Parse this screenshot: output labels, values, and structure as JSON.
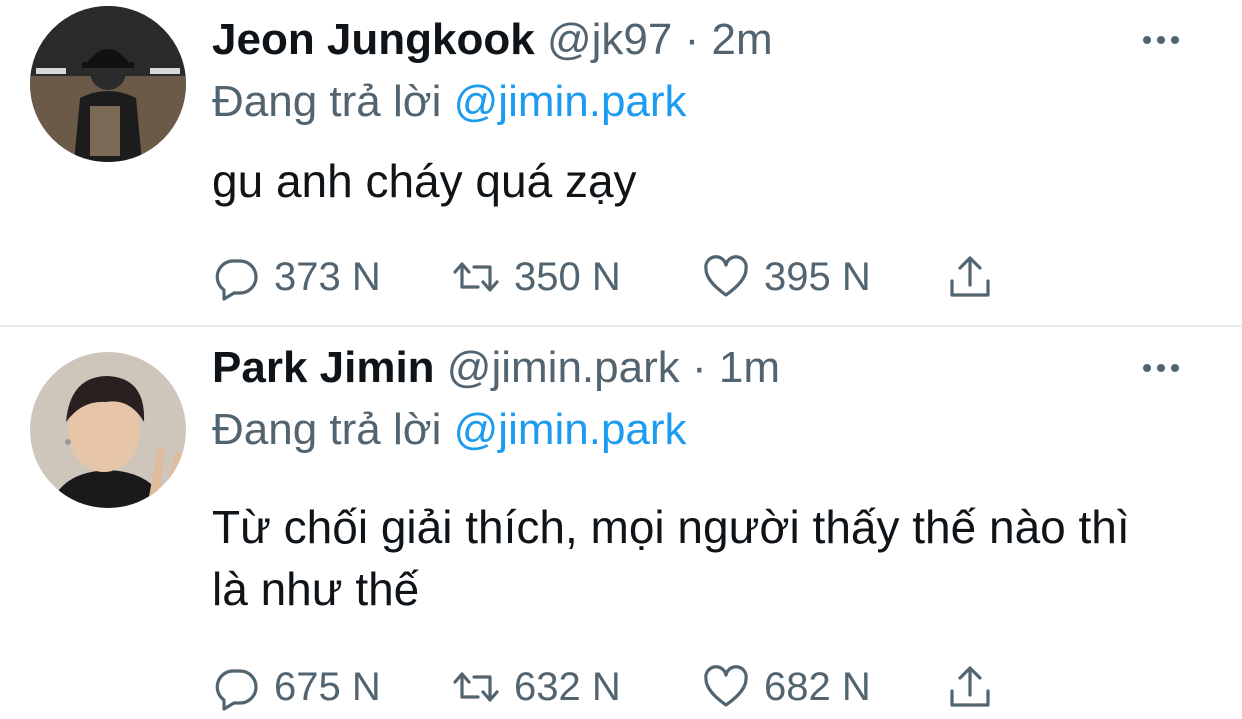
{
  "tweets": [
    {
      "name": "Jeon Jungkook",
      "handle": "@jk97",
      "separator": "·",
      "time": "2m",
      "replying_prefix": "Đang trả lời",
      "replying_to": "@jimin.park",
      "text": "gu anh cháy quá zạy",
      "replies": "373 N",
      "retweets": "350 N",
      "likes": "395 N"
    },
    {
      "name": "Park Jimin",
      "handle": "@jimin.park",
      "separator": "·",
      "time": "1m",
      "replying_prefix": "Đang trả lời",
      "replying_to": "@jimin.park",
      "text": "Từ chối giải thích, mọi người thấy thế nào thì là như thế",
      "replies": "675 N",
      "retweets": "632 N",
      "likes": "682 N"
    }
  ],
  "icons": {
    "more": "more-horizontal-icon",
    "reply": "reply-bubble-icon",
    "retweet": "retweet-icon",
    "like": "heart-icon",
    "share": "share-upload-icon"
  },
  "colors": {
    "text": "#0f1419",
    "secondary": "#536471",
    "accent": "#1d9bf0",
    "divider": "#e6ecf0"
  }
}
